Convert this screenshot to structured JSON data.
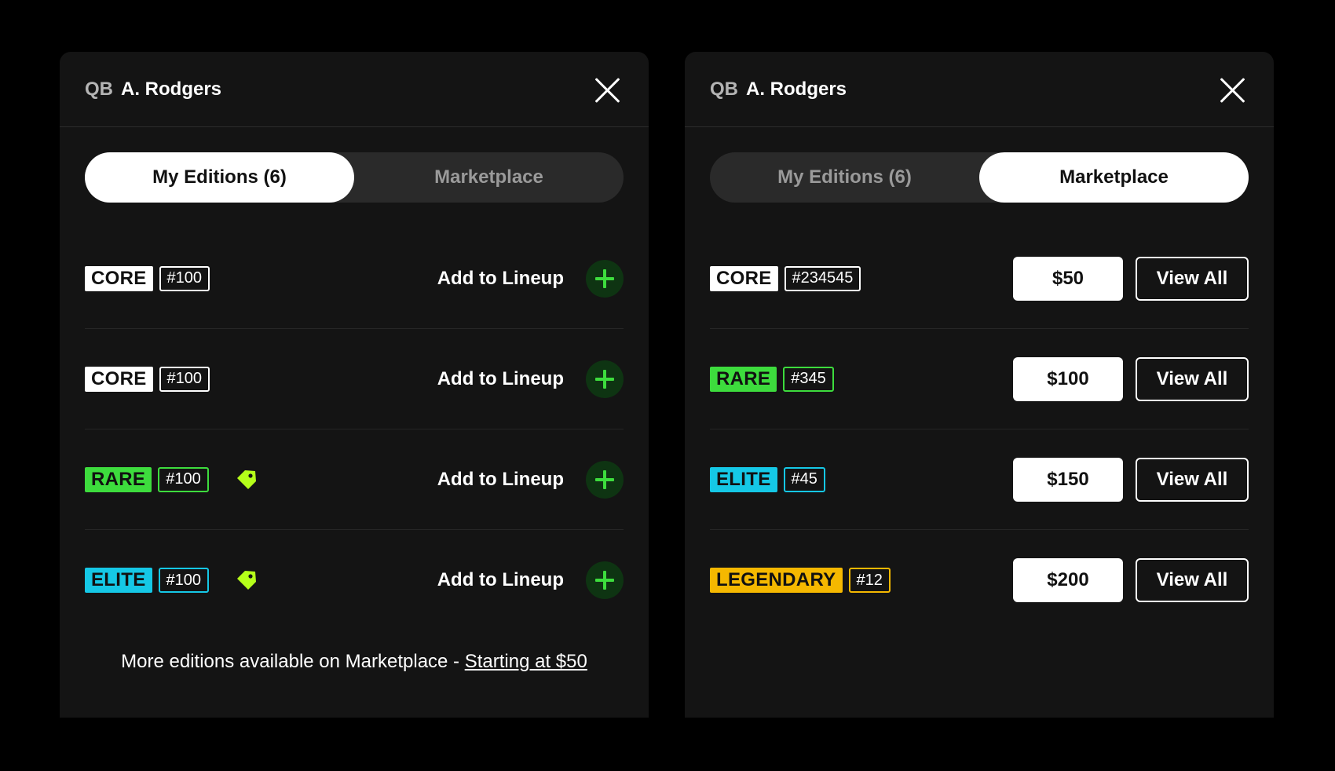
{
  "colors": {
    "core": "#ffffff",
    "rare": "#3ddc3d",
    "elite": "#15c8e6",
    "legendary": "#f5b800",
    "tag_icon": "#b5ff1a",
    "add_plus": "#3ddc3d"
  },
  "left_panel": {
    "position": "QB",
    "player_name": "A. Rodgers",
    "close_icon": "close-icon",
    "tabs": [
      {
        "label": "My Editions (6)",
        "active": true
      },
      {
        "label": "Marketplace",
        "active": false
      }
    ],
    "rows": [
      {
        "tier": "CORE",
        "tier_key": "core",
        "serial": "#100",
        "tag_icon": false,
        "action_label": "Add to Lineup"
      },
      {
        "tier": "CORE",
        "tier_key": "core",
        "serial": "#100",
        "tag_icon": false,
        "action_label": "Add to Lineup"
      },
      {
        "tier": "RARE",
        "tier_key": "rare",
        "serial": "#100",
        "tag_icon": true,
        "action_label": "Add to Lineup"
      },
      {
        "tier": "ELITE",
        "tier_key": "elite",
        "serial": "#100",
        "tag_icon": true,
        "action_label": "Add to Lineup"
      }
    ],
    "footer": {
      "text": "More editions available on Marketplace - ",
      "link": "Starting at $50"
    }
  },
  "right_panel": {
    "position": "QB",
    "player_name": "A. Rodgers",
    "close_icon": "close-icon",
    "tabs": [
      {
        "label": "My Editions (6)",
        "active": false
      },
      {
        "label": "Marketplace",
        "active": true
      }
    ],
    "rows": [
      {
        "tier": "CORE",
        "tier_key": "core",
        "serial": "#234545",
        "price": "$50",
        "action_label": "View All"
      },
      {
        "tier": "RARE",
        "tier_key": "rare",
        "serial": "#345",
        "price": "$100",
        "action_label": "View All"
      },
      {
        "tier": "ELITE",
        "tier_key": "elite",
        "serial": "#45",
        "price": "$150",
        "action_label": "View All"
      },
      {
        "tier": "LEGENDARY",
        "tier_key": "legendary",
        "serial": "#12",
        "price": "$200",
        "action_label": "View All"
      }
    ]
  }
}
